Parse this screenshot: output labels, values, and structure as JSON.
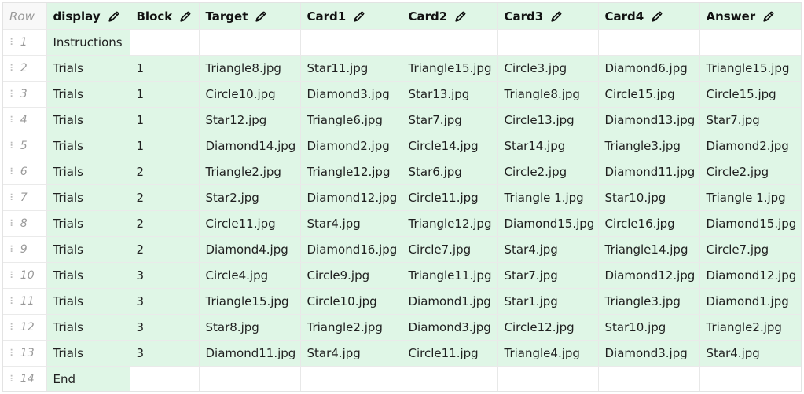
{
  "header": {
    "row_label": "Row",
    "columns": [
      "display",
      "Block",
      "Target",
      "Card1",
      "Card2",
      "Card3",
      "Card4",
      "Answer"
    ]
  },
  "rows": [
    {
      "num": "1",
      "cells": [
        "Instructions",
        "",
        "",
        "",
        "",
        "",
        "",
        ""
      ]
    },
    {
      "num": "2",
      "cells": [
        "Trials",
        "1",
        "Triangle8.jpg",
        "Star11.jpg",
        "Triangle15.jpg",
        "Circle3.jpg",
        "Diamond6.jpg",
        "Triangle15.jpg"
      ]
    },
    {
      "num": "3",
      "cells": [
        "Trials",
        "1",
        "Circle10.jpg",
        "Diamond3.jpg",
        "Star13.jpg",
        "Triangle8.jpg",
        "Circle15.jpg",
        "Circle15.jpg"
      ]
    },
    {
      "num": "4",
      "cells": [
        "Trials",
        "1",
        "Star12.jpg",
        "Triangle6.jpg",
        "Star7.jpg",
        "Circle13.jpg",
        "Diamond13.jpg",
        "Star7.jpg"
      ]
    },
    {
      "num": "5",
      "cells": [
        "Trials",
        "1",
        "Diamond14.jpg",
        "Diamond2.jpg",
        "Circle14.jpg",
        "Star14.jpg",
        "Triangle3.jpg",
        "Diamond2.jpg"
      ]
    },
    {
      "num": "6",
      "cells": [
        "Trials",
        "2",
        "Triangle2.jpg",
        "Triangle12.jpg",
        "Star6.jpg",
        "Circle2.jpg",
        "Diamond11.jpg",
        "Circle2.jpg"
      ]
    },
    {
      "num": "7",
      "cells": [
        "Trials",
        "2",
        "Star2.jpg",
        "Diamond12.jpg",
        "Circle11.jpg",
        "Triangle 1.jpg",
        "Star10.jpg",
        "Triangle 1.jpg"
      ]
    },
    {
      "num": "8",
      "cells": [
        "Trials",
        "2",
        "Circle11.jpg",
        "Star4.jpg",
        "Triangle12.jpg",
        "Diamond15.jpg",
        "Circle16.jpg",
        "Diamond15.jpg"
      ]
    },
    {
      "num": "9",
      "cells": [
        "Trials",
        "2",
        "Diamond4.jpg",
        "Diamond16.jpg",
        "Circle7.jpg",
        "Star4.jpg",
        "Triangle14.jpg",
        "Circle7.jpg"
      ]
    },
    {
      "num": "10",
      "cells": [
        "Trials",
        "3",
        "Circle4.jpg",
        "Circle9.jpg",
        "Triangle11.jpg",
        "Star7.jpg",
        "Diamond12.jpg",
        "Diamond12.jpg"
      ]
    },
    {
      "num": "11",
      "cells": [
        "Trials",
        "3",
        "Triangle15.jpg",
        "Circle10.jpg",
        "Diamond1.jpg",
        "Star1.jpg",
        "Triangle3.jpg",
        "Diamond1.jpg"
      ]
    },
    {
      "num": "12",
      "cells": [
        "Trials",
        "3",
        "Star8.jpg",
        "Triangle2.jpg",
        "Diamond3.jpg",
        "Circle12.jpg",
        "Star10.jpg",
        "Triangle2.jpg"
      ]
    },
    {
      "num": "13",
      "cells": [
        "Trials",
        "3",
        "Diamond11.jpg",
        "Star4.jpg",
        "Circle11.jpg",
        "Triangle4.jpg",
        "Diamond3.jpg",
        "Star4.jpg"
      ]
    },
    {
      "num": "14",
      "cells": [
        "End",
        "",
        "",
        "",
        "",
        "",
        "",
        ""
      ]
    }
  ],
  "icons": {
    "column_edit": "pencil-icon",
    "row_drag": "drag-handle-icon"
  },
  "colors": {
    "filled_cell": "#dff6e6",
    "empty_cell": "#ffffff",
    "row_number": "#9a9a9a"
  }
}
